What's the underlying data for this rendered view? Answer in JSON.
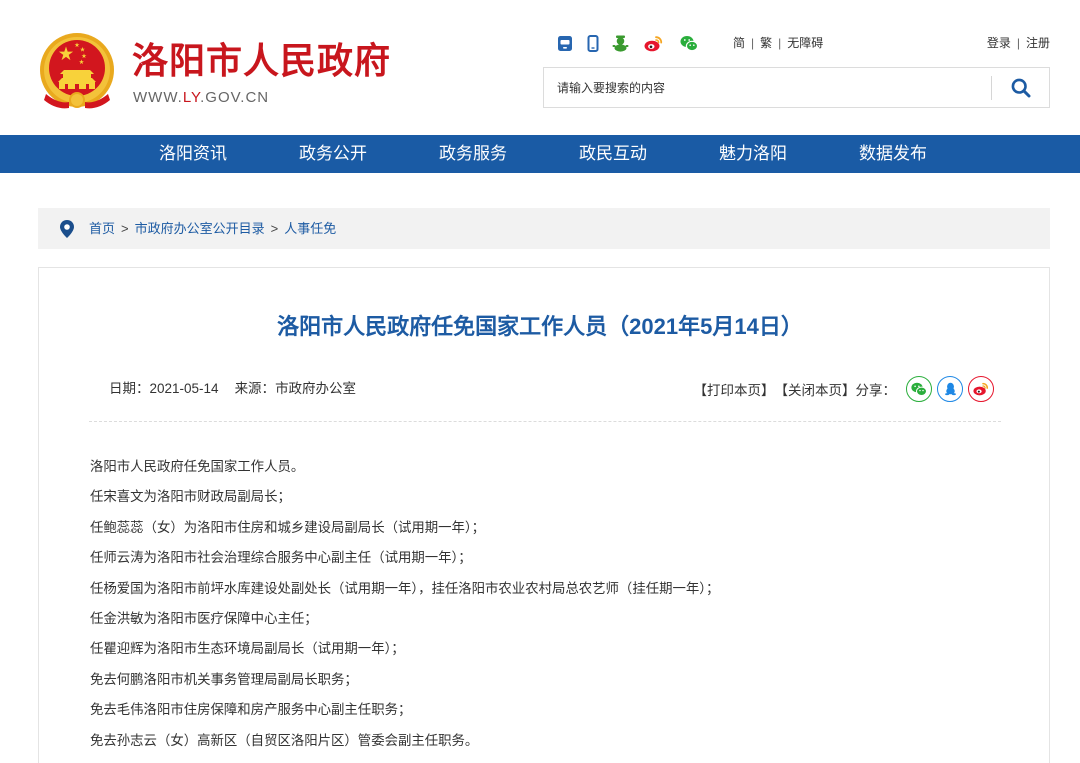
{
  "header": {
    "site_title": "洛阳市人民政府",
    "site_url": {
      "prefix": "WWW.",
      "highlight": "LY",
      "suffix": ".GOV.CN"
    },
    "emblem": "national-emblem",
    "tool_icons": [
      "app-icon",
      "mobile-icon",
      "mini-program-icon",
      "weibo-icon",
      "wechat-icon"
    ],
    "lang": {
      "simplified": "简",
      "traditional": "繁",
      "accessibility": "无障碍",
      "separator": "|"
    },
    "account": {
      "login": "登录",
      "register": "注册",
      "separator": "|"
    },
    "search": {
      "placeholder": "请输入要搜索的内容",
      "button_icon": "search-icon"
    }
  },
  "nav": {
    "items": [
      {
        "label": "洛阳资讯"
      },
      {
        "label": "政务公开"
      },
      {
        "label": "政务服务"
      },
      {
        "label": "政民互动"
      },
      {
        "label": "魅力洛阳"
      },
      {
        "label": "数据发布"
      }
    ]
  },
  "breadcrumb": {
    "icon": "location-pin-icon",
    "items": [
      "首页",
      "市政府办公室公开目录",
      "人事任免"
    ],
    "separator": ">"
  },
  "article": {
    "title": "洛阳市人民政府任免国家工作人员（2021年5月14日）",
    "date_label": "日期：",
    "date": "2021-05-14",
    "source_label": "来源：",
    "source": "市政府办公室",
    "print": "【打印本页】",
    "close": "【关闭本页】",
    "share_label": "分享：",
    "share_icons": [
      "wechat-icon",
      "qq-icon",
      "weibo-icon"
    ],
    "paragraphs": [
      "洛阳市人民政府任免国家工作人员。",
      "任宋喜文为洛阳市财政局副局长；",
      "任鲍蕊蕊（女）为洛阳市住房和城乡建设局副局长（试用期一年）；",
      "任师云涛为洛阳市社会治理综合服务中心副主任（试用期一年）；",
      "任杨爱国为洛阳市前坪水库建设处副处长（试用期一年），挂任洛阳市农业农村局总农艺师（挂任期一年）；",
      "任金洪敏为洛阳市医疗保障中心主任；",
      "任瞿迎辉为洛阳市生态环境局副局长（试用期一年）；",
      "免去何鹏洛阳市机关事务管理局副局长职务；",
      "免去毛伟洛阳市住房保障和房产服务中心副主任职务；",
      "免去孙志云（女）高新区（自贸区洛阳片区）管委会副主任职务。"
    ]
  },
  "colors": {
    "brand_red": "#c8161d",
    "nav_blue": "#1a5ba5",
    "link_blue": "#1d5ba3",
    "breadcrumb_bg": "#f2f2f2",
    "share_wechat": "#2aae3c",
    "share_qq": "#1e88e5",
    "share_weibo": "#e6162d"
  }
}
